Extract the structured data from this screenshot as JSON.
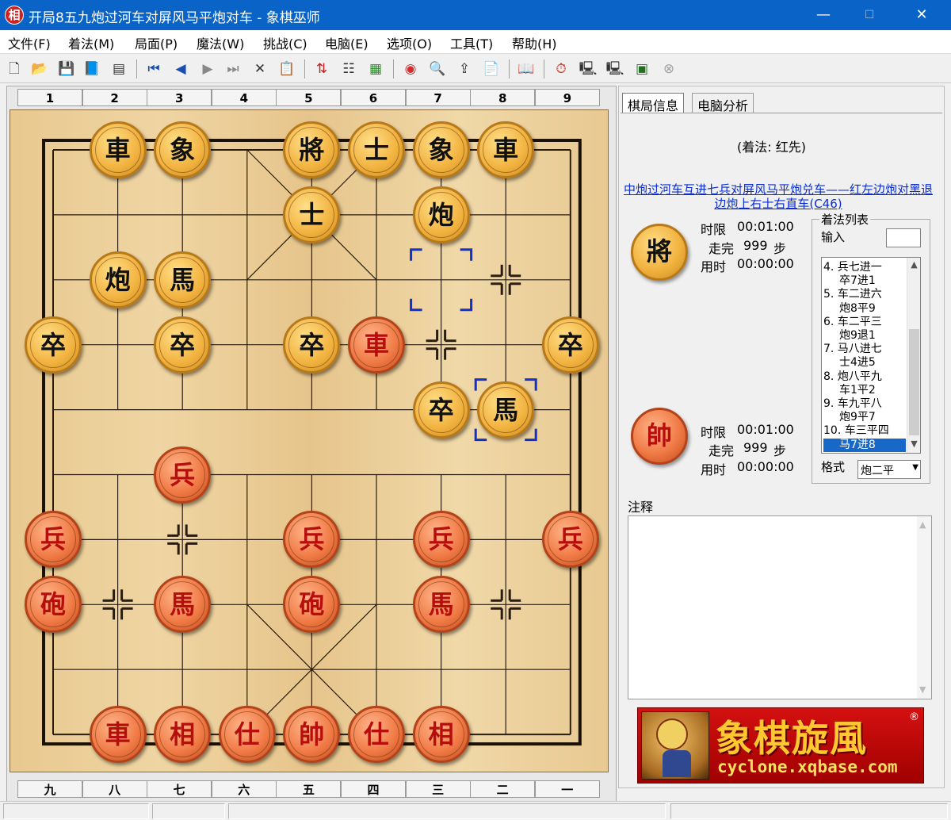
{
  "window": {
    "app_icon_char": "相",
    "title": "开局8五九炮过河车对屏风马平炮对车 - 象棋巫师",
    "controls": {
      "minimize": "—",
      "maximize": "☐",
      "close": "✕"
    }
  },
  "menu": [
    "文件(F)",
    "着法(M)",
    "局面(P)",
    "魔法(W)",
    "挑战(C)",
    "电脑(E)",
    "选项(O)",
    "工具(T)",
    "帮助(H)"
  ],
  "toolbar_icons": [
    {
      "name": "new-file-icon",
      "glyph": "🗋"
    },
    {
      "name": "open-folder-icon",
      "glyph": "📂"
    },
    {
      "name": "save-icon",
      "glyph": "💾"
    },
    {
      "name": "book-icon",
      "glyph": "📘"
    },
    {
      "name": "properties-icon",
      "glyph": "▤"
    },
    {
      "name": "first-move-icon",
      "glyph": "⏮"
    },
    {
      "name": "prev-move-icon",
      "glyph": "◀"
    },
    {
      "name": "next-move-icon",
      "glyph": "▶"
    },
    {
      "name": "last-move-icon",
      "glyph": "⏭"
    },
    {
      "name": "delete-icon",
      "glyph": "✕"
    },
    {
      "name": "paste-icon",
      "glyph": "📋"
    },
    {
      "name": "flip-board-icon",
      "glyph": "⇅"
    },
    {
      "name": "tree-icon",
      "glyph": "☷"
    },
    {
      "name": "calculator-icon",
      "glyph": "▦"
    },
    {
      "name": "color-wheel-icon",
      "glyph": "◉"
    },
    {
      "name": "search-icon",
      "glyph": "🔍"
    },
    {
      "name": "export-icon",
      "glyph": "⇪"
    },
    {
      "name": "clipboard-icon",
      "glyph": "📄"
    },
    {
      "name": "library-icon",
      "glyph": "📖"
    },
    {
      "name": "timer-icon",
      "glyph": "⏱"
    },
    {
      "name": "computer-icon",
      "glyph": "🖳"
    },
    {
      "name": "computer-alt-icon",
      "glyph": "🖳"
    },
    {
      "name": "monitor-icon",
      "glyph": "▣"
    },
    {
      "name": "stop-icon",
      "glyph": "⊗"
    }
  ],
  "board": {
    "top_labels": [
      "1",
      "2",
      "3",
      "4",
      "5",
      "6",
      "7",
      "8",
      "9"
    ],
    "bottom_labels": [
      "九",
      "八",
      "七",
      "六",
      "五",
      "四",
      "三",
      "二",
      "一"
    ],
    "pieces": [
      {
        "char": "車",
        "side": "black",
        "col": 1,
        "row": 0
      },
      {
        "char": "象",
        "side": "black",
        "col": 2,
        "row": 0
      },
      {
        "char": "將",
        "side": "black",
        "col": 4,
        "row": 0
      },
      {
        "char": "士",
        "side": "black",
        "col": 5,
        "row": 0
      },
      {
        "char": "象",
        "side": "black",
        "col": 6,
        "row": 0
      },
      {
        "char": "車",
        "side": "black",
        "col": 7,
        "row": 0
      },
      {
        "char": "士",
        "side": "black",
        "col": 4,
        "row": 1
      },
      {
        "char": "炮",
        "side": "black",
        "col": 6,
        "row": 1
      },
      {
        "char": "炮",
        "side": "black",
        "col": 1,
        "row": 2
      },
      {
        "char": "馬",
        "side": "black",
        "col": 2,
        "row": 2
      },
      {
        "char": "卒",
        "side": "black",
        "col": 0,
        "row": 3
      },
      {
        "char": "卒",
        "side": "black",
        "col": 2,
        "row": 3
      },
      {
        "char": "卒",
        "side": "black",
        "col": 4,
        "row": 3
      },
      {
        "char": "車",
        "side": "red",
        "col": 5,
        "row": 3
      },
      {
        "char": "卒",
        "side": "black",
        "col": 8,
        "row": 3
      },
      {
        "char": "卒",
        "side": "black",
        "col": 6,
        "row": 4
      },
      {
        "char": "馬",
        "side": "black",
        "col": 7,
        "row": 4
      },
      {
        "char": "兵",
        "side": "red",
        "col": 2,
        "row": 5
      },
      {
        "char": "兵",
        "side": "red",
        "col": 0,
        "row": 6
      },
      {
        "char": "兵",
        "side": "red",
        "col": 4,
        "row": 6
      },
      {
        "char": "兵",
        "side": "red",
        "col": 6,
        "row": 6
      },
      {
        "char": "兵",
        "side": "red",
        "col": 8,
        "row": 6
      },
      {
        "char": "砲",
        "side": "red",
        "col": 0,
        "row": 7
      },
      {
        "char": "馬",
        "side": "red",
        "col": 2,
        "row": 7
      },
      {
        "char": "砲",
        "side": "red",
        "col": 4,
        "row": 7
      },
      {
        "char": "馬",
        "side": "red",
        "col": 6,
        "row": 7
      },
      {
        "char": "車",
        "side": "red",
        "col": 1,
        "row": 9
      },
      {
        "char": "相",
        "side": "red",
        "col": 2,
        "row": 9
      },
      {
        "char": "仕",
        "side": "red",
        "col": 3,
        "row": 9
      },
      {
        "char": "帥",
        "side": "red",
        "col": 4,
        "row": 9
      },
      {
        "char": "仕",
        "side": "red",
        "col": 5,
        "row": 9
      },
      {
        "char": "相",
        "side": "red",
        "col": 6,
        "row": 9
      }
    ],
    "last_move": {
      "from": {
        "col": 6,
        "row": 2
      },
      "to": {
        "col": 7,
        "row": 4
      }
    },
    "markers": [
      {
        "col": 7,
        "row": 2
      },
      {
        "col": 6,
        "row": 3
      },
      {
        "col": 2,
        "row": 6
      },
      {
        "col": 1,
        "row": 7
      },
      {
        "col": 7,
        "row": 7
      }
    ]
  },
  "tabs": [
    "棋局信息",
    "电脑分析"
  ],
  "info": {
    "move_side": "(着法: 红先)",
    "opening_name": "中炮过河车互进七兵对屏风马平炮兑车——红左边炮对黑退边炮上右士右直车(C46)"
  },
  "black_player": {
    "avatar_char": "將",
    "time_limit_label": "时限",
    "time_limit": "00:01:00",
    "moves_label": "走完",
    "moves_count": "999",
    "moves_unit": "步",
    "used_label": "用时",
    "used": "00:00:00"
  },
  "red_player": {
    "avatar_char": "帥",
    "time_limit_label": "时限",
    "time_limit": "00:01:00",
    "moves_label": "走完",
    "moves_count": "999",
    "moves_unit": "步",
    "used_label": "用时",
    "used": "00:00:00"
  },
  "move_list": {
    "title": "着法列表",
    "input_label": "输入",
    "input_value": "",
    "entries": [
      "4. 兵七进一",
      "卒7进1",
      "5. 车二进六",
      "炮8平9",
      "6. 车二平三",
      "炮9退1",
      "7. 马八进七",
      "士4进5",
      "8. 炮八平九",
      "车1平2",
      "9. 车九平八",
      "炮9平7",
      "10. 车三平四",
      "马7进8"
    ],
    "selected_index": 13,
    "format_label": "格式",
    "format_value": "炮二平"
  },
  "notes": {
    "label": "注释",
    "content": ""
  },
  "ad": {
    "title": "象棋旋風",
    "url": "cyclone.xqbase.com",
    "registered_mark": "®"
  },
  "status_bar": [
    "",
    "",
    "",
    ""
  ]
}
